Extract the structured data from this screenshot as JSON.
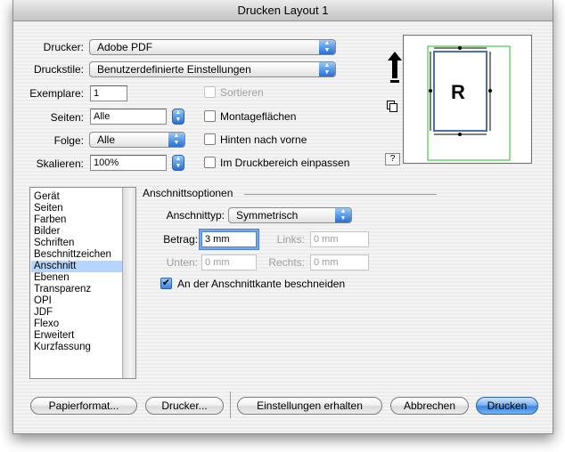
{
  "window": {
    "title": "Drucken Layout 1"
  },
  "top": {
    "drucker_label": "Drucker:",
    "drucker_value": "Adobe PDF",
    "druckstile_label": "Druckstile:",
    "druckstile_value": "Benutzerdefinierte Einstellungen",
    "exemplare_label": "Exemplare:",
    "exemplare_value": "1",
    "seiten_label": "Seiten:",
    "seiten_value": "Alle",
    "folge_label": "Folge:",
    "folge_value": "Alle",
    "skalieren_label": "Skalieren:",
    "skalieren_value": "100%"
  },
  "options": {
    "sortieren": {
      "label": "Sortieren",
      "checked": false,
      "enabled": false
    },
    "montageflaechen": {
      "label": "Montageflächen",
      "checked": false,
      "enabled": true
    },
    "hinten_nach_vorne": {
      "label": "Hinten nach vorne",
      "checked": false,
      "enabled": true
    },
    "im_druckbereich": {
      "label": "Im Druckbereich einpassen",
      "checked": false,
      "enabled": true
    }
  },
  "preview": {
    "page_letter": "R",
    "help_label": "?"
  },
  "sidebar": {
    "items": [
      {
        "label": "Gerät",
        "selected": false
      },
      {
        "label": "Seiten",
        "selected": false
      },
      {
        "label": "Farben",
        "selected": false
      },
      {
        "label": "Bilder",
        "selected": false
      },
      {
        "label": "Schriften",
        "selected": false
      },
      {
        "label": "Beschnittzeichen",
        "selected": false
      },
      {
        "label": "Anschnitt",
        "selected": true
      },
      {
        "label": "Ebenen",
        "selected": false
      },
      {
        "label": "Transparenz",
        "selected": false
      },
      {
        "label": "OPI",
        "selected": false
      },
      {
        "label": "JDF",
        "selected": false
      },
      {
        "label": "Flexo",
        "selected": false
      },
      {
        "label": "Erweitert",
        "selected": false
      },
      {
        "label": "Kurzfassung",
        "selected": false
      }
    ]
  },
  "panel": {
    "heading": "Anschnittsoptionen",
    "typ_label": "Anschnittyp:",
    "typ_value": "Symmetrisch",
    "betrag_label": "Betrag:",
    "betrag_value": "3 mm",
    "links_label": "Links:",
    "links_value": "0 mm",
    "unten_label": "Unten:",
    "unten_value": "0 mm",
    "rechts_label": "Rechts:",
    "rechts_value": "0 mm",
    "beschneiden_label": "An der Anschnittkante beschneiden",
    "beschneiden_checked": true
  },
  "buttons": {
    "papierformat": "Papierformat...",
    "drucker": "Drucker...",
    "einstellungen": "Einstellungen erhalten",
    "abbrechen": "Abbrechen",
    "drucken": "Drucken"
  },
  "colors": {
    "accent": "#3c86df",
    "selection": "#b5d5ff",
    "preview_media": "#22c022",
    "preview_page": "#4a6fb5"
  }
}
